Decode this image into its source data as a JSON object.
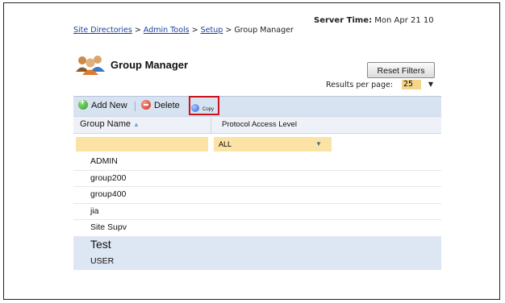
{
  "breadcrumb": {
    "items": [
      "Site Directories",
      "Admin Tools",
      "Setup"
    ],
    "separator": ">",
    "current": "Group Manager"
  },
  "server_time": {
    "label": "Server Time:",
    "value": "Mon Apr 21 10"
  },
  "page": {
    "title": "Group Manager",
    "icon": "users-group-icon"
  },
  "filters": {
    "reset_label": "Reset Filters",
    "protocol_filter_value": "ALL"
  },
  "pagination": {
    "results_per_page_label": "Results per page:",
    "results_per_page_value": "25"
  },
  "toolbar": {
    "add_label": "Add New",
    "delete_label": "Delete",
    "copy_label": "Copy"
  },
  "table": {
    "columns": [
      "Group Name",
      "Protocol Access Level"
    ],
    "rows": [
      {
        "name": "ADMIN",
        "selected": false
      },
      {
        "name": "group200",
        "selected": false
      },
      {
        "name": "group400",
        "selected": false
      },
      {
        "name": "jia",
        "selected": false
      },
      {
        "name": "Site Supv",
        "selected": false
      },
      {
        "name": "Test",
        "selected": true
      },
      {
        "name": "USER",
        "selected": true
      }
    ]
  },
  "colors": {
    "toolbar_bg": "#d7e3f1",
    "filter_bg": "#fbe2a5",
    "highlight_border": "#c8141e",
    "selected_row": "#dde6f3"
  }
}
